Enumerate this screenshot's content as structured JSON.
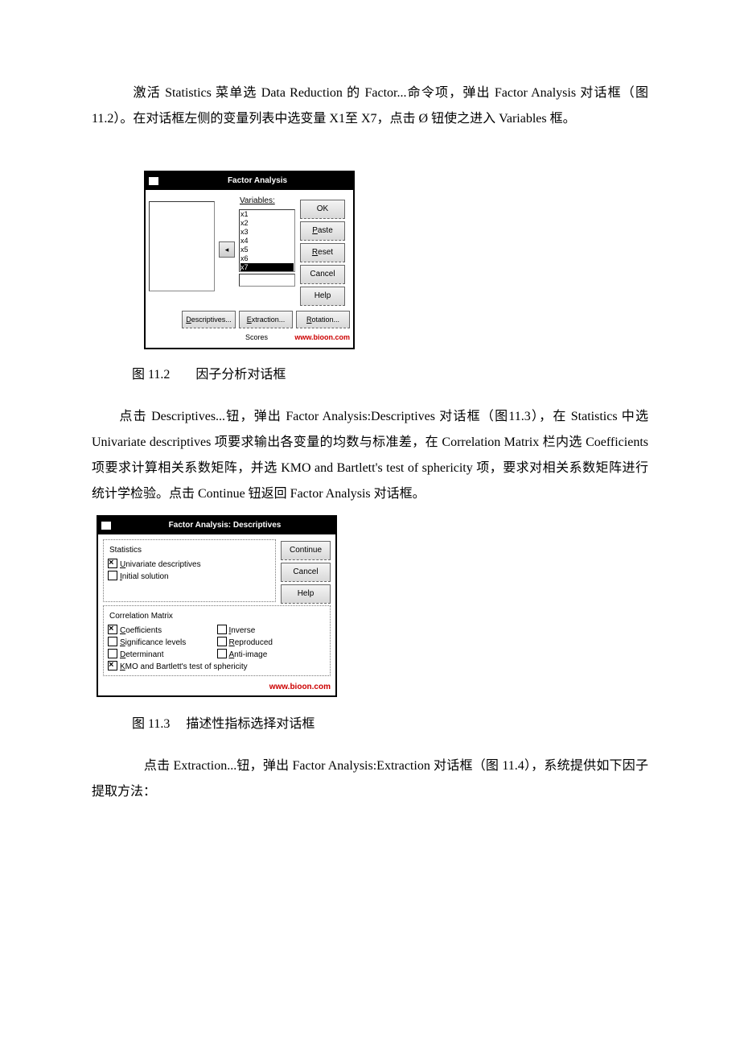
{
  "para1": "　　　激活 Statistics 菜单选 Data Reduction 的 Factor...命令项，弹出 Factor Analysis 对话框（图 11.2）。在对话框左侧的变量列表中选变量 X1至 X7，点击 Ø 钮使之进入 Variables 框。",
  "caption1": "图 11.2　　因子分析对话框",
  "para2": "　　点击 Descriptives...钮，弹出 Factor Analysis:Descriptives 对话框（图11.3），在 Statistics 中选 Univariate descriptives 项要求输出各变量的均数与标准差，在 Correlation Matrix 栏内选 Coefficients 项要求计算相关系数矩阵，并选 KMO and Bartlett's test of sphericity 项，要求对相关系数矩阵进行统计学检验。点击 Continue 钮返回 Factor Analysis 对话框。",
  "caption2": "图 11.3　 描述性指标选择对话框",
  "para3": "　　　　点击 Extraction...钮，弹出 Factor Analysis:Extraction 对话框（图 11.4），系统提供如下因子提取方法：",
  "dlg1": {
    "title": "Factor Analysis",
    "var_label": "Variables:",
    "vars": [
      "x1",
      "x2",
      "x3",
      "x4",
      "x5",
      "x6",
      "x7"
    ],
    "move": "◂",
    "btns": {
      "ok": "OK",
      "paste_u": "P",
      "paste_rest": "aste",
      "reset_u": "R",
      "reset_rest": "eset",
      "cancel": "Cancel",
      "help": "Help"
    },
    "bottom": {
      "desc_u": "D",
      "desc_rest": "escriptives...",
      "ext_u": "E",
      "ext_rest": "xtraction...",
      "rot_u": "R",
      "rot_rest": "otation..."
    },
    "scores_label": "Scores",
    "watermark": "www.bioon.com"
  },
  "dlg2": {
    "title": "Factor Analysis: Descriptives",
    "stats_title": "Statistics",
    "univ_u": "U",
    "univ_rest": "nivariate descriptives",
    "init_u": "I",
    "init_rest": "nitial solution",
    "btns": {
      "cont": "Continue",
      "cancel": "Cancel",
      "help": "Help"
    },
    "cm_title": "Correlation Matrix",
    "coef_u": "C",
    "coef_rest": "oefficients",
    "inv_u": "I",
    "inv_rest": "nverse",
    "sig_u": "S",
    "sig_rest": "ignificance levels",
    "rep_u": "R",
    "rep_rest": "eproduced",
    "det_u": "D",
    "det_rest": "eterminant",
    "anti_u": "A",
    "anti_rest": "nti-image",
    "kmo_u": "K",
    "kmo_rest": "MO and Bartlett's test of sphericity",
    "watermark": "www.bioon.com"
  }
}
